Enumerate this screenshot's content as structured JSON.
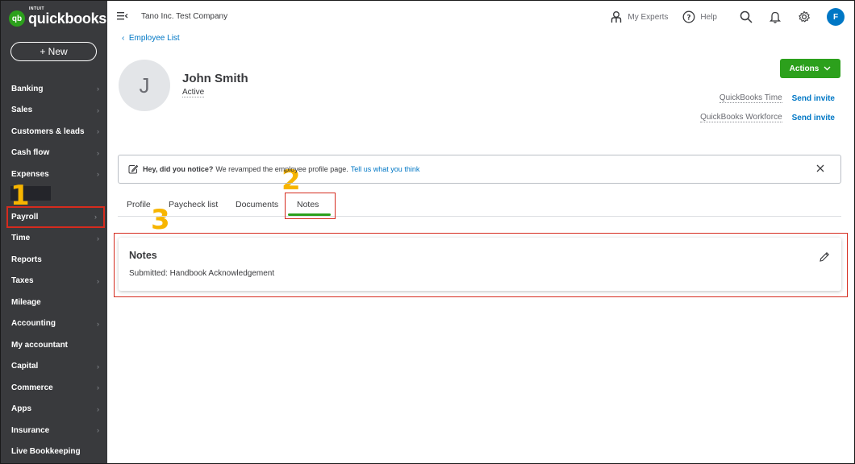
{
  "app": {
    "logo_small": "INTUIT",
    "logo_text": "quickbooks",
    "logo_badge": "qb",
    "company": "Tano Inc. Test Company"
  },
  "sidebar": {
    "new_label": "+ New",
    "items": [
      {
        "label": "Banking",
        "chevron": true
      },
      {
        "label": "Sales",
        "chevron": true
      },
      {
        "label": "Customers & leads",
        "chevron": true
      },
      {
        "label": "Cash flow",
        "chevron": true
      },
      {
        "label": "Expenses",
        "chevron": true
      },
      {
        "label": "",
        "chevron": false
      },
      {
        "label": "Payroll",
        "chevron": true
      },
      {
        "label": "Time",
        "chevron": true
      },
      {
        "label": "Reports",
        "chevron": false
      },
      {
        "label": "Taxes",
        "chevron": true
      },
      {
        "label": "Mileage",
        "chevron": false
      },
      {
        "label": "Accounting",
        "chevron": true
      },
      {
        "label": "My accountant",
        "chevron": false
      },
      {
        "label": "Capital",
        "chevron": true
      },
      {
        "label": "Commerce",
        "chevron": true
      },
      {
        "label": "Apps",
        "chevron": true
      },
      {
        "label": "Insurance",
        "chevron": true
      },
      {
        "label": "Live Bookkeeping",
        "chevron": false
      }
    ]
  },
  "topbar": {
    "my_experts": "My Experts",
    "help": "Help",
    "avatar_initial": "F"
  },
  "employee": {
    "breadcrumb": "Employee List",
    "initial": "J",
    "name": "John Smith",
    "status": "Active",
    "actions_label": "Actions",
    "invites": [
      {
        "label": "QuickBooks Time",
        "action": "Send invite"
      },
      {
        "label": "QuickBooks Workforce",
        "action": "Send invite"
      }
    ]
  },
  "notice": {
    "bold": "Hey, did you notice?",
    "text": "We revamped the employee profile page.",
    "link": "Tell us what you think"
  },
  "tabs": [
    "Profile",
    "Paycheck list",
    "Documents",
    "Notes"
  ],
  "notes": {
    "title": "Notes",
    "text": "Submitted: Handbook Acknowledgement"
  },
  "annotations": [
    "1",
    "2",
    "3"
  ],
  "colors": {
    "sidebar": "#393a3d",
    "accent_green": "#2ca01c",
    "link_blue": "#0077c5",
    "highlight_red": "#d52b1e",
    "annotation_yellow": "#f7b500"
  }
}
